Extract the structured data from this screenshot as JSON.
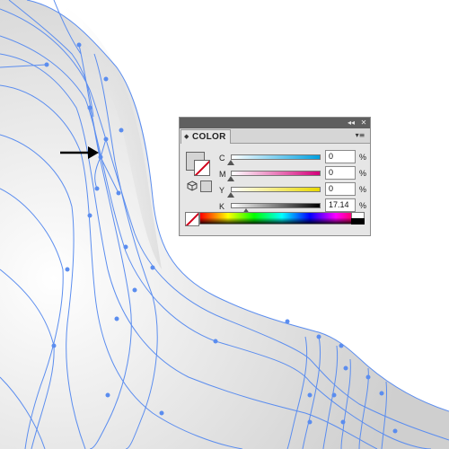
{
  "panel": {
    "tab_label": "COLOR",
    "tab_arrow": "◆",
    "collapse_glyph": "◂◂",
    "close_glyph": "✕",
    "menu_glyph": "▾≡",
    "channels": [
      {
        "label": "C",
        "value": "0",
        "unit": "%",
        "level": 0,
        "gradient": [
          "#ffffff",
          "#00a0e0"
        ]
      },
      {
        "label": "M",
        "value": "0",
        "unit": "%",
        "level": 0,
        "gradient": [
          "#ffffff",
          "#d4007a"
        ]
      },
      {
        "label": "Y",
        "value": "0",
        "unit": "%",
        "level": 0,
        "gradient": [
          "#ffffff",
          "#e8d800"
        ]
      },
      {
        "label": "K",
        "value": "17.14",
        "unit": "%",
        "level": 17.14,
        "gradient": [
          "#ffffff",
          "#000000"
        ]
      }
    ],
    "fill_color": "#d4d4d4",
    "none_color": "#d0021b"
  },
  "canvas": {
    "line_color": "#5b8def",
    "arrow_color": "#000000"
  }
}
